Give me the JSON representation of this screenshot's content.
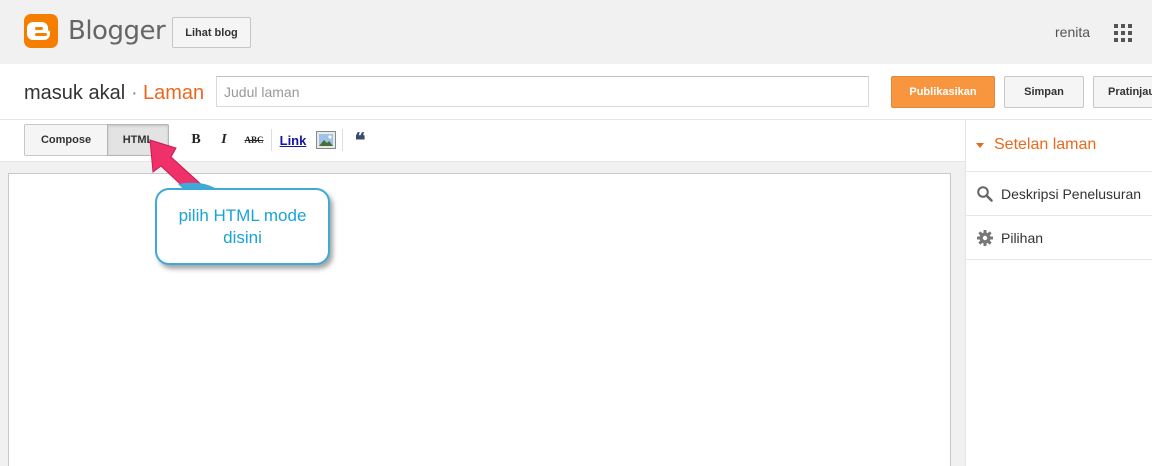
{
  "topbar": {
    "logo_icon": "blogger-logo-icon",
    "logo_text": "Blogger",
    "view_blog_label": "Lihat blog",
    "user_name": "renita",
    "apps_icon": "apps-grid-icon"
  },
  "title_row": {
    "blog_name": "masuk akal",
    "separator": "·",
    "page_type": "Laman",
    "title_placeholder": "Judul laman",
    "publish_label": "Publikasikan",
    "save_label": "Simpan",
    "preview_label": "Pratinjau"
  },
  "toolbar": {
    "compose_label": "Compose",
    "html_label": "HTML",
    "bold_label": "B",
    "italic_label": "I",
    "strike_label": "ABC",
    "link_label": "Link",
    "image_icon": "insert-image-icon",
    "quote_label": "❝"
  },
  "sidebar": {
    "title": "Setelan laman",
    "items": [
      {
        "label": "Deskripsi Penelusuran",
        "icon": "search-icon"
      },
      {
        "label": "Pilihan",
        "icon": "gear-icon"
      }
    ]
  },
  "annotation": {
    "line1": "pilih HTML mode",
    "line2": "disini"
  },
  "colors": {
    "accent": "#e8691d",
    "publish": "#f8963f",
    "callout_border": "#3fa9d8",
    "callout_arrow": "#f0306a"
  }
}
